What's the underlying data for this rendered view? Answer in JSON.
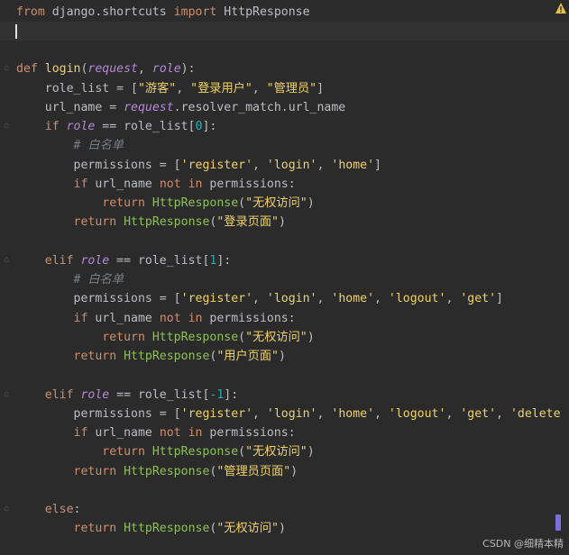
{
  "editor": {
    "lines": [
      [
        {
          "t": "from ",
          "c": "s-kw"
        },
        {
          "t": "django.shortcuts ",
          "c": "s-plain"
        },
        {
          "t": "import ",
          "c": "s-kw"
        },
        {
          "t": "HttpResponse",
          "c": "s-plain"
        }
      ],
      [],
      [],
      [
        {
          "t": "def ",
          "c": "s-kw"
        },
        {
          "t": "login",
          "c": "s-fname"
        },
        {
          "t": "(",
          "c": "s-plain"
        },
        {
          "t": "request",
          "c": "s-param"
        },
        {
          "t": ", ",
          "c": "s-plain"
        },
        {
          "t": "role",
          "c": "s-param"
        },
        {
          "t": "):",
          "c": "s-plain"
        }
      ],
      [
        {
          "t": "    role_list = [",
          "c": "s-plain"
        },
        {
          "t": "\"游客\"",
          "c": "s-fname"
        },
        {
          "t": ", ",
          "c": "s-plain"
        },
        {
          "t": "\"登录用户\"",
          "c": "s-fname"
        },
        {
          "t": ", ",
          "c": "s-plain"
        },
        {
          "t": "\"管理员\"",
          "c": "s-fname"
        },
        {
          "t": "]",
          "c": "s-plain"
        }
      ],
      [
        {
          "t": "    url_name = ",
          "c": "s-plain"
        },
        {
          "t": "request",
          "c": "s-param"
        },
        {
          "t": ".resolver_match.url_name",
          "c": "s-plain"
        }
      ],
      [
        {
          "t": "    ",
          "c": "s-plain"
        },
        {
          "t": "if ",
          "c": "s-kw"
        },
        {
          "t": "role",
          "c": "s-param"
        },
        {
          "t": " == role_list[",
          "c": "s-plain"
        },
        {
          "t": "0",
          "c": "s-num"
        },
        {
          "t": "]:",
          "c": "s-plain"
        }
      ],
      [
        {
          "t": "        # 白名单",
          "c": "s-cmt"
        }
      ],
      [
        {
          "t": "        permissions = [",
          "c": "s-plain"
        },
        {
          "t": "'register'",
          "c": "s-fname"
        },
        {
          "t": ", ",
          "c": "s-plain"
        },
        {
          "t": "'login'",
          "c": "s-fname"
        },
        {
          "t": ", ",
          "c": "s-plain"
        },
        {
          "t": "'home'",
          "c": "s-fname"
        },
        {
          "t": "]",
          "c": "s-plain"
        }
      ],
      [
        {
          "t": "        ",
          "c": "s-plain"
        },
        {
          "t": "if ",
          "c": "s-kw"
        },
        {
          "t": "url_name ",
          "c": "s-plain"
        },
        {
          "t": "not in ",
          "c": "s-kw"
        },
        {
          "t": "permissions:",
          "c": "s-plain"
        }
      ],
      [
        {
          "t": "            ",
          "c": "s-plain"
        },
        {
          "t": "return ",
          "c": "s-kw"
        },
        {
          "t": "HttpResponse",
          "c": "s-http"
        },
        {
          "t": "(",
          "c": "s-plain"
        },
        {
          "t": "\"无权访问\"",
          "c": "s-fname"
        },
        {
          "t": ")",
          "c": "s-plain"
        }
      ],
      [
        {
          "t": "        ",
          "c": "s-plain"
        },
        {
          "t": "return ",
          "c": "s-kw"
        },
        {
          "t": "HttpResponse",
          "c": "s-http"
        },
        {
          "t": "(",
          "c": "s-plain"
        },
        {
          "t": "\"登录页面\"",
          "c": "s-fname"
        },
        {
          "t": ")",
          "c": "s-plain"
        }
      ],
      [],
      [
        {
          "t": "    ",
          "c": "s-plain"
        },
        {
          "t": "elif ",
          "c": "s-kw"
        },
        {
          "t": "role",
          "c": "s-param"
        },
        {
          "t": " == role_list[",
          "c": "s-plain"
        },
        {
          "t": "1",
          "c": "s-num"
        },
        {
          "t": "]:",
          "c": "s-plain"
        }
      ],
      [
        {
          "t": "        # 白名单",
          "c": "s-cmt"
        }
      ],
      [
        {
          "t": "        permissions = [",
          "c": "s-plain"
        },
        {
          "t": "'register'",
          "c": "s-fname"
        },
        {
          "t": ", ",
          "c": "s-plain"
        },
        {
          "t": "'login'",
          "c": "s-fname"
        },
        {
          "t": ", ",
          "c": "s-plain"
        },
        {
          "t": "'home'",
          "c": "s-fname"
        },
        {
          "t": ", ",
          "c": "s-plain"
        },
        {
          "t": "'logout'",
          "c": "s-fname"
        },
        {
          "t": ", ",
          "c": "s-plain"
        },
        {
          "t": "'get'",
          "c": "s-fname"
        },
        {
          "t": "]",
          "c": "s-plain"
        }
      ],
      [
        {
          "t": "        ",
          "c": "s-plain"
        },
        {
          "t": "if ",
          "c": "s-kw"
        },
        {
          "t": "url_name ",
          "c": "s-plain"
        },
        {
          "t": "not in ",
          "c": "s-kw"
        },
        {
          "t": "permissions:",
          "c": "s-plain"
        }
      ],
      [
        {
          "t": "            ",
          "c": "s-plain"
        },
        {
          "t": "return ",
          "c": "s-kw"
        },
        {
          "t": "HttpResponse",
          "c": "s-http"
        },
        {
          "t": "(",
          "c": "s-plain"
        },
        {
          "t": "\"无权访问\"",
          "c": "s-fname"
        },
        {
          "t": ")",
          "c": "s-plain"
        }
      ],
      [
        {
          "t": "        ",
          "c": "s-plain"
        },
        {
          "t": "return ",
          "c": "s-kw"
        },
        {
          "t": "HttpResponse",
          "c": "s-http"
        },
        {
          "t": "(",
          "c": "s-plain"
        },
        {
          "t": "\"用户页面\"",
          "c": "s-fname"
        },
        {
          "t": ")",
          "c": "s-plain"
        }
      ],
      [],
      [
        {
          "t": "    ",
          "c": "s-plain"
        },
        {
          "t": "elif ",
          "c": "s-kw"
        },
        {
          "t": "role",
          "c": "s-param"
        },
        {
          "t": " == role_list[",
          "c": "s-plain"
        },
        {
          "t": "-1",
          "c": "s-num"
        },
        {
          "t": "]:",
          "c": "s-plain"
        }
      ],
      [
        {
          "t": "        permissions = [",
          "c": "s-plain"
        },
        {
          "t": "'register'",
          "c": "s-fname"
        },
        {
          "t": ", ",
          "c": "s-plain"
        },
        {
          "t": "'login'",
          "c": "s-fname"
        },
        {
          "t": ", ",
          "c": "s-plain"
        },
        {
          "t": "'home'",
          "c": "s-fname"
        },
        {
          "t": ", ",
          "c": "s-plain"
        },
        {
          "t": "'logout'",
          "c": "s-fname"
        },
        {
          "t": ", ",
          "c": "s-plain"
        },
        {
          "t": "'get'",
          "c": "s-fname"
        },
        {
          "t": ", ",
          "c": "s-plain"
        },
        {
          "t": "'delete",
          "c": "s-fname"
        }
      ],
      [
        {
          "t": "        ",
          "c": "s-plain"
        },
        {
          "t": "if ",
          "c": "s-kw"
        },
        {
          "t": "url_name ",
          "c": "s-plain"
        },
        {
          "t": "not in ",
          "c": "s-kw"
        },
        {
          "t": "permissions:",
          "c": "s-plain"
        }
      ],
      [
        {
          "t": "            ",
          "c": "s-plain"
        },
        {
          "t": "return ",
          "c": "s-kw"
        },
        {
          "t": "HttpResponse",
          "c": "s-http"
        },
        {
          "t": "(",
          "c": "s-plain"
        },
        {
          "t": "\"无权访问\"",
          "c": "s-fname"
        },
        {
          "t": ")",
          "c": "s-plain"
        }
      ],
      [
        {
          "t": "        ",
          "c": "s-plain"
        },
        {
          "t": "return ",
          "c": "s-kw"
        },
        {
          "t": "HttpResponse",
          "c": "s-http"
        },
        {
          "t": "(",
          "c": "s-plain"
        },
        {
          "t": "\"管理员页面\"",
          "c": "s-fname"
        },
        {
          "t": ")",
          "c": "s-plain"
        }
      ],
      [],
      [
        {
          "t": "    ",
          "c": "s-plain"
        },
        {
          "t": "else",
          "c": "s-kw"
        },
        {
          "t": ":",
          "c": "s-plain"
        }
      ],
      [
        {
          "t": "        ",
          "c": "s-plain"
        },
        {
          "t": "return ",
          "c": "s-kw"
        },
        {
          "t": "HttpResponse",
          "c": "s-http"
        },
        {
          "t": "(",
          "c": "s-plain"
        },
        {
          "t": "\"无权访问\"",
          "c": "s-fname"
        },
        {
          "t": ")",
          "c": "s-plain"
        }
      ],
      []
    ],
    "current_line": 1,
    "fold_lines": [
      3,
      6,
      13,
      20,
      26
    ],
    "colors": {
      "background": "#2b2b2b",
      "current_line": "#323232",
      "keyword": "#cf8e6d",
      "string": "#f0d268",
      "number": "#2aacb8",
      "parameter": "#b589d6",
      "comment": "#7a7e85",
      "warning": "#e8c14a",
      "scroll_marker": "#7b6fd8"
    },
    "warning_icon": "warning-triangle-icon"
  },
  "watermark": "CSDN @细精本精"
}
